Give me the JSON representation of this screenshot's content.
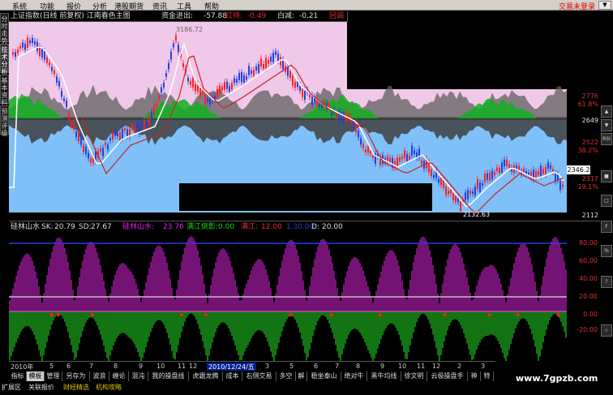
{
  "menu": {
    "items": [
      "系统",
      "功能",
      "报价",
      "分析",
      "港股期货",
      "资讯",
      "工具",
      "帮助"
    ],
    "status": "交易未登录",
    "dropdown": "▼"
  },
  "left_tabs": [
    "分时走势",
    "技术分析",
    "基本资料",
    "预测评级"
  ],
  "chart_header": {
    "title": "上证指数(日线 前复权) 江南春色主图",
    "fund_in_label": "资金进出:",
    "fund_in_value": "-57.88",
    "red_label": "红持:",
    "red_value": "-0.49",
    "white_label": "白减:",
    "white_value": "-0.21",
    "right_label": "回调临"
  },
  "price_axis": {
    "ticks": [
      {
        "label": "2776",
        "color": "red"
      },
      {
        "label": "61.8%",
        "color": "red"
      },
      {
        "label": "2649",
        "color": "white"
      },
      {
        "label": "2522",
        "color": "red"
      },
      {
        "label": "38.2%",
        "color": "red"
      },
      {
        "label": "2317",
        "color": "red"
      },
      {
        "label": "19.1%",
        "color": "red"
      },
      {
        "label": "2112",
        "color": "white"
      }
    ],
    "current_price": "2346.2"
  },
  "chart_annotations": {
    "high_label": "3186.72",
    "low_label": "2132.63"
  },
  "indicator_header": {
    "name": "硅林山水",
    "sk_label": "SK:",
    "sk_value": "20.79",
    "sd_label": "SD:",
    "sd_value": "27.67",
    "name2": "硅林山水:",
    "name2_value": "23.76",
    "bei_label": "满江倒影:",
    "bei_value": "0.00",
    "red_label": "满江:",
    "red_value": "12.00",
    "blue_value": "1.30.00",
    "d_label": "D:",
    "d_value": "20.00"
  },
  "indicator_axis": [
    "80.00",
    "60.00",
    "40.00",
    "20.00",
    "0.00",
    "-20.00"
  ],
  "date_bar": {
    "items": [
      "2010年",
      "5",
      "6",
      "7",
      "8",
      "9",
      "10",
      "11",
      "12"
    ],
    "highlight": "2010/12/24/五",
    "items2": [
      "3",
      "5",
      "6",
      "7",
      "8",
      "9",
      "10",
      "11",
      "12",
      "2",
      "3"
    ]
  },
  "bottom_tabs": [
    "指标",
    "模板",
    "管理",
    "另存为",
    "波浪",
    "缠论",
    "混沌",
    "我的操盘线",
    "虎踞龙腾",
    "成本",
    "右侧交易",
    "多空",
    "解",
    "稳坐泰山",
    "绝对牛",
    "黑牛均线",
    "徐文明",
    "云极操盘手",
    "神",
    "特"
  ],
  "bottom_tabs2": [
    "扩展区",
    "关联报价",
    "财经精选",
    "机构攻略"
  ],
  "side_buttons": [
    "▲",
    "▼",
    "RSI",
    "■",
    "□",
    "F",
    "%",
    "?",
    "☆"
  ],
  "watermark": "www.7gpzb.com",
  "colors": {
    "pink_bg": "#f0c8e8",
    "blue_bg": "#80c0f8",
    "green_fill": "#10b020",
    "magenta_bar": "#c020c0",
    "up_red": "#ff2020",
    "down_blue": "#2040e0"
  },
  "chart_data": {
    "type": "candlestick-with-indicator",
    "title": "上证指数(日线 前复权) 江南春色主图",
    "ylim": [
      2112,
      2776
    ],
    "ytick_labels": [
      "2776",
      "2649",
      "2522",
      "2317",
      "2112"
    ],
    "percent_levels": [
      "61.8%",
      "38.2%",
      "19.1%"
    ],
    "indicator_ylim": [
      -20,
      80
    ],
    "indicator_ticks": [
      "80.00",
      "60.00",
      "40.00",
      "20.00",
      "0.00",
      "-20.00"
    ]
  }
}
